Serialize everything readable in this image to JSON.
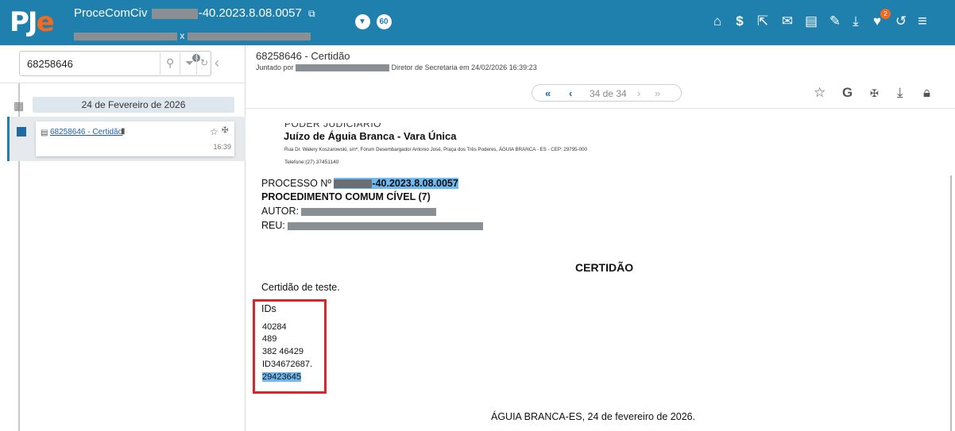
{
  "header": {
    "logo_pj": "PJ",
    "logo_e": "e",
    "process_prefix": "ProceComCiv",
    "process_suffix": "-40.2023.8.08.0057",
    "parties_separator": "x",
    "counter_badge": "60",
    "notification_count": "2"
  },
  "search": {
    "value": "68258646",
    "filter_count": "3"
  },
  "timeline": {
    "date_label": "24 de Fevereiro de 2026",
    "doc_link": "68258646 - Certidão",
    "doc_time": "16:39"
  },
  "viewer": {
    "title": "68258646 - Certidão",
    "juntado_prefix": "Juntado por",
    "juntado_suffix": "Diretor de Secretaria em 24/02/2026 16:39:23",
    "pager_text": "34 de 34"
  },
  "document": {
    "court_header": "PODER JUDICIÁRIO",
    "court_name": "Juízo de Águia Branca - Vara Única",
    "address": "Rua Dr. Walery Koszarowski, s/nº, Fórum Desembargador Antonio José, Praça dos Três Poderes, ÁGUIA BRANCA - ES - CEP: 29795-000",
    "phone": "Telefone:(27) 37451140",
    "processo_label": "PROCESSO Nº",
    "processo_number": "-40.2023.8.08.0057",
    "procedimento": "PROCEDIMENTO COMUM CÍVEL (7)",
    "autor_label": "AUTOR:",
    "reu_label": "REU:",
    "cert_title": "CERTIDÃO",
    "cert_text": "Certidão de teste.",
    "ids_label": "IDs",
    "ids": [
      "40284",
      "489",
      "382 46429",
      "ID34672687.",
      "29423645"
    ],
    "place_date": "ÁGUIA BRANCA-ES, 24 de fevereiro de 2026."
  },
  "colors": {
    "header_bg": "#1f7fad",
    "accent_orange": "#f26b21",
    "highlight": "#6fb8f0",
    "box_red": "#d9262b"
  },
  "icons": [
    "home-icon",
    "dollar-icon",
    "external-link-icon",
    "envelope-icon",
    "file-plus-icon",
    "edit-icon",
    "download-icon",
    "shield-bell-icon",
    "undo-icon",
    "menu-icon"
  ]
}
